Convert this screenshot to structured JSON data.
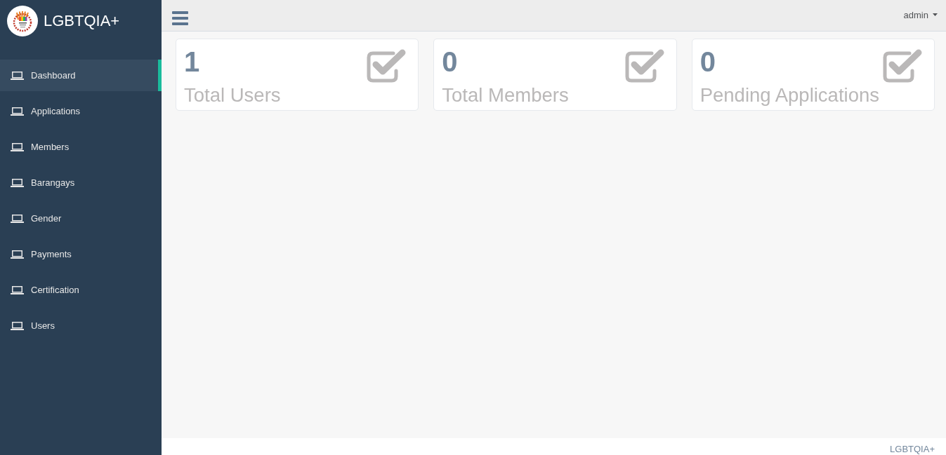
{
  "sidebar": {
    "brand": "LGBTQIA+",
    "items": [
      {
        "label": "Dashboard",
        "selected": true
      },
      {
        "label": "Applications",
        "selected": false
      },
      {
        "label": "Members",
        "selected": false
      },
      {
        "label": "Barangays",
        "selected": false
      },
      {
        "label": "Gender",
        "selected": false
      },
      {
        "label": "Payments",
        "selected": false
      },
      {
        "label": "Certification",
        "selected": false
      },
      {
        "label": "Users",
        "selected": false
      }
    ]
  },
  "top_nav": {
    "user": "admin"
  },
  "stats": [
    {
      "count": "1",
      "label": "Total Users"
    },
    {
      "count": "0",
      "label": "Total Members"
    },
    {
      "count": "0",
      "label": "Pending Applications"
    }
  ],
  "footer": {
    "text": "LGBTQIA+"
  }
}
